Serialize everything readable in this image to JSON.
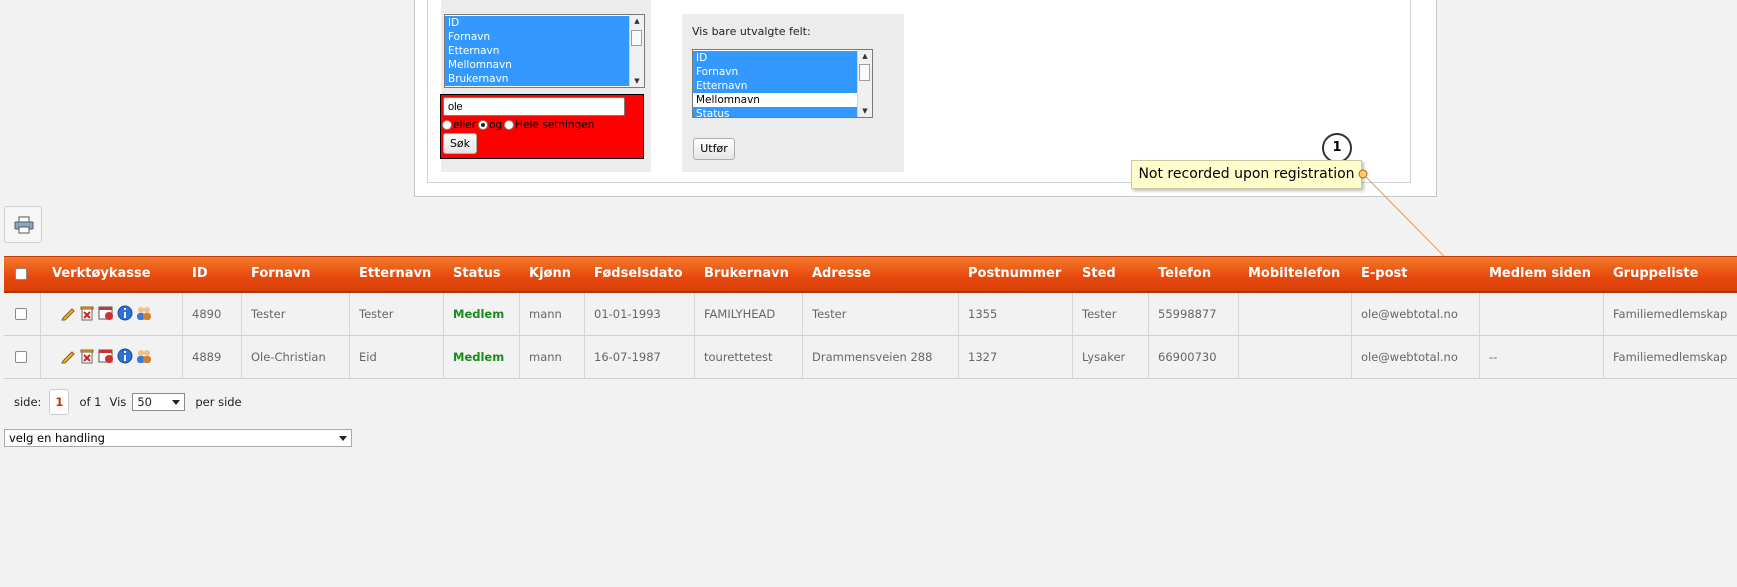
{
  "filters": {
    "search_fields": [
      "ID",
      "Fornavn",
      "Etternavn",
      "Mellomnavn",
      "Brukernavn"
    ],
    "search_text": "ole",
    "match_options": [
      "eller",
      "og",
      "Hele setningen"
    ],
    "match_selected": "og",
    "search_button": "Søk",
    "show_fields_label": "Vis bare utvalgte felt:",
    "show_fields": [
      {
        "label": "ID",
        "selected": true
      },
      {
        "label": "Fornavn",
        "selected": true
      },
      {
        "label": "Etternavn",
        "selected": true
      },
      {
        "label": "Mellomnavn",
        "selected": false
      },
      {
        "label": "Status",
        "selected": true
      }
    ],
    "apply_button": "Utfør"
  },
  "annotation": {
    "number": "1",
    "text": "Not recorded upon registration"
  },
  "table": {
    "headers": [
      "Verktøykasse",
      "ID",
      "Fornavn",
      "Etternavn",
      "Status",
      "Kjønn",
      "Fødselsdato",
      "Brukernavn",
      "Adresse",
      "Postnummer",
      "Sted",
      "Telefon",
      "Mobiltelefon",
      "E-post",
      "Medlem siden",
      "Gruppeliste"
    ],
    "rows": [
      [
        "4890",
        "Tester",
        "Tester",
        "Medlem",
        "mann",
        "01-01-1993",
        "FAMILYHEAD",
        "Tester",
        "1355",
        "Tester",
        "55998877",
        "",
        "ole@webtotal.no",
        "",
        "Familiemedlemskap"
      ],
      [
        "4889",
        "Ole-Christian",
        "Eid",
        "Medlem",
        "mann",
        "16-07-1987",
        "tourettetest",
        "Drammensveien 288",
        "1327",
        "Lysaker",
        "66900730",
        "",
        "ole@webtotal.no",
        "--",
        "Familiemedlemskap"
      ]
    ],
    "tool_icons": [
      "edit-icon",
      "delete-icon",
      "calendar-icon",
      "info-icon",
      "group-icon"
    ]
  },
  "pager": {
    "side_label": "side:",
    "page": "1",
    "of_text": "of 1",
    "vis_label": "Vis",
    "per_page": "50",
    "per_side_label": "per side"
  },
  "action_select": {
    "value": "velg en handling"
  },
  "colors": {
    "header_orange": "#e6480c",
    "status_green": "#1a8a1a",
    "selection_blue": "#3399ff",
    "search_red": "#ff0000",
    "callout_yellow": "#ffffcc"
  }
}
